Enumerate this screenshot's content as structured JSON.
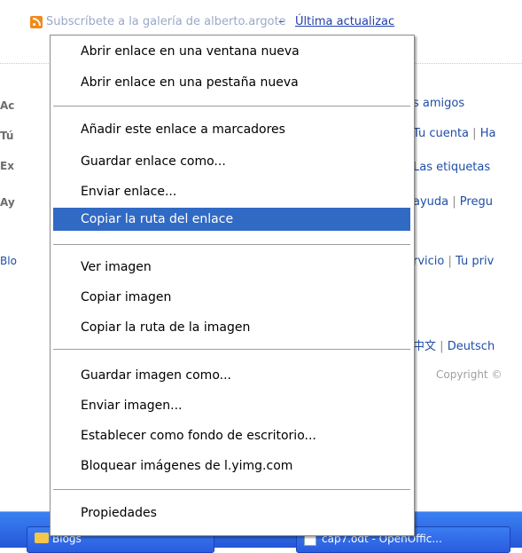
{
  "background_page": {
    "subscribe_text": "Subscríbete a la galería de alberto.argote",
    "subscribe_dash": "–",
    "subscribe_link": "Última actualizac",
    "side_labels": [
      "Ac",
      "Tú",
      "Ex",
      "Ay",
      "Blo"
    ],
    "right_column": [
      {
        "a": "s amigos",
        "b": ""
      },
      {
        "a": "Tu cuenta",
        "b": "Ha"
      },
      {
        "a": "Las etiquetas",
        "b": ""
      },
      {
        "a": "ayuda",
        "b": "Pregu"
      },
      {
        "a": "rvicio",
        "b": "Tu priv"
      },
      {
        "a": "中文",
        "b": "Deutsch"
      }
    ],
    "separator_char": "|",
    "copyright": "Copyright ©"
  },
  "taskbar": {
    "left_button": "Blogs",
    "right_button": "cap7.odt - OpenOffic..."
  },
  "context_menu": {
    "items": [
      {
        "label": "Abrir enlace en una ventana nueva",
        "highlighted": false
      },
      {
        "label": "Abrir enlace en una pestaña nueva",
        "highlighted": false
      },
      {
        "label": "Añadir este enlace a marcadores",
        "highlighted": false
      },
      {
        "label": "Guardar enlace como...",
        "highlighted": false
      },
      {
        "label": "Enviar enlace...",
        "highlighted": false
      },
      {
        "label": "Copiar la ruta del enlace",
        "highlighted": true
      },
      {
        "label": "Ver imagen",
        "highlighted": false
      },
      {
        "label": "Copiar imagen",
        "highlighted": false
      },
      {
        "label": "Copiar la ruta de la imagen",
        "highlighted": false
      },
      {
        "label": "Guardar imagen como...",
        "highlighted": false
      },
      {
        "label": "Enviar imagen...",
        "highlighted": false
      },
      {
        "label": "Establecer como fondo de escritorio...",
        "highlighted": false
      },
      {
        "label": "Bloquear imágenes de l.yimg.com",
        "highlighted": false
      },
      {
        "label": "Propiedades",
        "highlighted": false
      }
    ]
  },
  "colors": {
    "highlight": "#316ac5",
    "link": "#1f4ea8",
    "rss": "#f28a1b",
    "taskbar": "#2457d6"
  },
  "icons": [
    "rss-icon",
    "folder-icon",
    "document-icon"
  ]
}
